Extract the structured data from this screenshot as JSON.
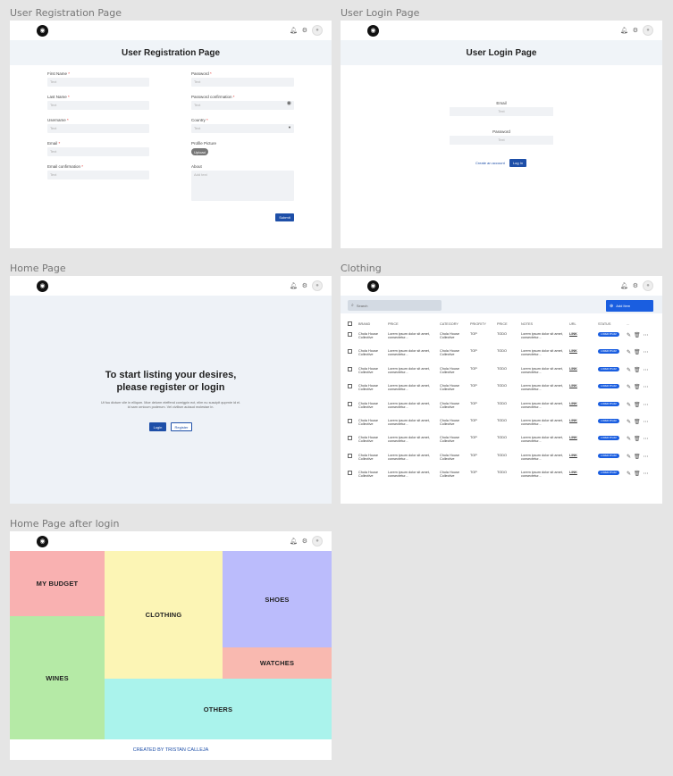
{
  "frames": {
    "registration": {
      "title": "User Registration Page"
    },
    "login": {
      "title": "User Login Page"
    },
    "home": {
      "title": "Home Page"
    },
    "clothing": {
      "title": "Clothing"
    },
    "home_after": {
      "title": "Home Page after login"
    }
  },
  "registration": {
    "heading": "User Registration Page",
    "left_fields": [
      {
        "label": "First Name",
        "required": "*",
        "placeholder": "Text"
      },
      {
        "label": "Last Name",
        "required": "*",
        "placeholder": "Text"
      },
      {
        "label": "Username",
        "required": "*",
        "placeholder": "Text"
      },
      {
        "label": "Email",
        "required": "*",
        "placeholder": "Text"
      },
      {
        "label": "Email confirmation",
        "required": "*",
        "placeholder": "Text"
      }
    ],
    "right_fields": {
      "password": {
        "label": "Password",
        "required": "*",
        "placeholder": "Text"
      },
      "password_confirm": {
        "label": "Password confirmation",
        "required": "*",
        "placeholder": "Text"
      },
      "country": {
        "label": "Country",
        "required": "*",
        "placeholder": "Text"
      },
      "picture": {
        "label": "Profile Picture",
        "button": "Upload"
      },
      "about": {
        "label": "About",
        "placeholder": "Add text"
      }
    },
    "submit": "Submit"
  },
  "login": {
    "heading": "User Login Page",
    "email_label": "Email",
    "email_placeholder": "Text",
    "password_label": "Password",
    "password_placeholder": "Text",
    "create_link": "Create an account",
    "login_button": "Log In"
  },
  "home": {
    "headline_1": "To start listing your desires,",
    "headline_2": "please register or login",
    "sub_1": "Ut fuu dictum vile in elliqum. Moe delorm eleffend comigpin ect, elim nu suscipit quprnie id el.",
    "sub_2": "Id sam ornicum poderum. Vel civilism autaud molestae in.",
    "login_button": "Login",
    "register_button": "Register"
  },
  "clothing": {
    "search_placeholder": "Search",
    "add_button": "Add Item",
    "columns": [
      "BRAND",
      "PRICE",
      "CATEGORY",
      "PRIORITY",
      "PRICE",
      "NOTES",
      "URL",
      "STATUS",
      "..."
    ],
    "row": {
      "brand": "Chola House Collective",
      "price": "Lorem ipsum dolor sit amet, consectetur...",
      "category": "Chola House Collective",
      "priority": "TOP",
      "price2": "TODO",
      "notes": "Lorem ipsum dolor sit amet, consectetur...",
      "url": "LINK",
      "status": "LOREM IPSUM"
    },
    "row_count": 9
  },
  "dashboard": {
    "tiles": {
      "budget": "MY BUDGET",
      "clothing": "CLOTHING",
      "shoes": "SHOES",
      "wines": "WINES",
      "watches": "WATCHES",
      "others": "OTHERS"
    },
    "footer": "CREATED BY TRISTAN CALLEJA"
  },
  "colors": {
    "primary": "#1e4fa8",
    "budget": "#f9b1b1",
    "clothing": "#fcf5b5",
    "shoes": "#bbbcfc",
    "wines": "#b5eaa6",
    "watches": "#f9b9b0",
    "others": "#aaf3ec"
  },
  "icons": {
    "bell": "bell-icon",
    "gear": "gear-icon",
    "avatar": "user-avatar-icon",
    "logo": "app-logo-icon"
  }
}
